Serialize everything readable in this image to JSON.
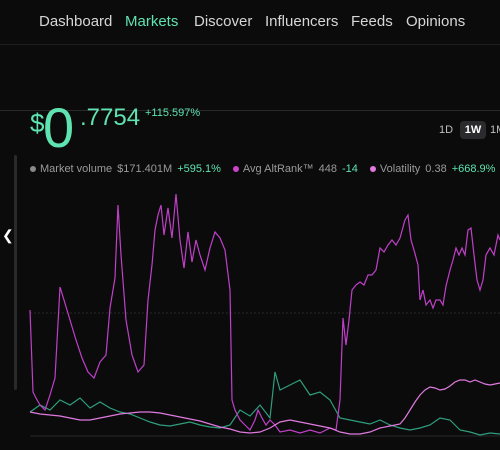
{
  "nav": {
    "items": [
      {
        "label": "Dashboard",
        "active": false
      },
      {
        "label": "Markets",
        "active": true
      },
      {
        "label": "Discover",
        "active": false
      },
      {
        "label": "Influencers",
        "active": false
      },
      {
        "label": "Feeds",
        "active": false
      },
      {
        "label": "Opinions",
        "active": false
      }
    ]
  },
  "price": {
    "currency_symbol": "$",
    "integer_part": "0",
    "decimal_part": ".7754",
    "change": "+115.597%"
  },
  "ranges": [
    {
      "label": "1D",
      "active": false
    },
    {
      "label": "1W",
      "active": true
    },
    {
      "label": "1M",
      "active": false
    }
  ],
  "legend": [
    {
      "label": "Market volume",
      "value": "$171.401M",
      "change": "+595.1%",
      "color": "#8a8a8a"
    },
    {
      "label": "Avg AltRank™",
      "value": "448",
      "change": "-14",
      "color": "#cc44cc"
    },
    {
      "label": "Volatility",
      "value": "0.38",
      "change": "+668.9%",
      "color": "#e07ae0"
    }
  ],
  "colors": {
    "accent": "#5fe3b0",
    "altrank": "#c040c8",
    "volatility": "#e07ae0",
    "market_volume": "#2f9e7c",
    "background": "#0b0b0c"
  },
  "icons": {
    "collapse": "chevron-left-icon"
  }
}
